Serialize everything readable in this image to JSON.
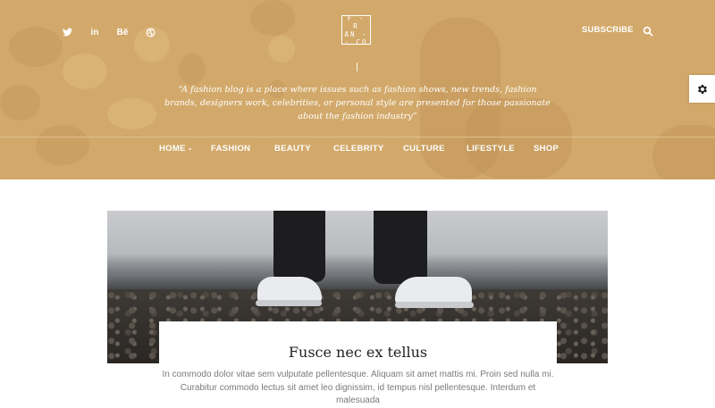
{
  "header": {
    "social": [
      {
        "name": "twitter-icon",
        "glyph": "🐦"
      },
      {
        "name": "linkedin-icon",
        "glyph": "in"
      },
      {
        "name": "behance-icon",
        "glyph": "Bē"
      },
      {
        "name": "dribbble-icon",
        "glyph": "◎"
      }
    ],
    "logo_lines": [
      "F - R",
      "AN -",
      "- CO"
    ],
    "subscribe_label": "SUBSCRIBE",
    "tagline": "“A fashion blog is a place where issues such as fashion shows, new trends, fashion brands, designers work, celebrities, or personal style are presented for those passionate about the fashion industry”",
    "background_color": "#d2a96a"
  },
  "nav": {
    "items": [
      "HOME",
      "FASHION",
      "BEAUTY",
      "CELEBRITY",
      "CULTURE",
      "LIFESTYLE",
      "SHOP"
    ]
  },
  "post": {
    "title": "Fusce nec ex tellus",
    "excerpt_line1": "In commodo dolor vitae sem vulputate pellentesque. Aliquam sit amet mattis mi. Proin sed nulla mi.",
    "excerpt_line2": "Curabitur commodo lectus sit amet leo dignissim, id tempus nisl pellentesque. Interdum et malesuada"
  },
  "icons": {
    "settings": "gear-icon",
    "search": "search-icon"
  }
}
